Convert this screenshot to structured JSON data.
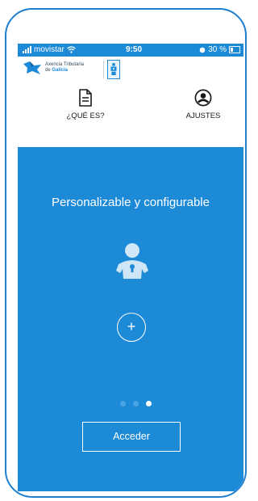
{
  "status_bar": {
    "carrier": "movistar",
    "time": "9:50",
    "battery": "30 %"
  },
  "logo": {
    "line1": "Axencia Tributaria",
    "line2_prefix": "de ",
    "line2_brand": "Galicia"
  },
  "nav": {
    "about_label": "¿QUÉ ES?",
    "settings_label": "AJUSTES"
  },
  "onboarding": {
    "headline": "Personalizable y configurable",
    "add_symbol": "+",
    "pages": 3,
    "current_page": 3,
    "access_label": "Acceder"
  },
  "colors": {
    "brand_blue": "#1d8ad7",
    "frame_blue": "#1e7fd0",
    "icon_light": "#cfe6f7",
    "dot_inactive": "#4aa3e2"
  }
}
